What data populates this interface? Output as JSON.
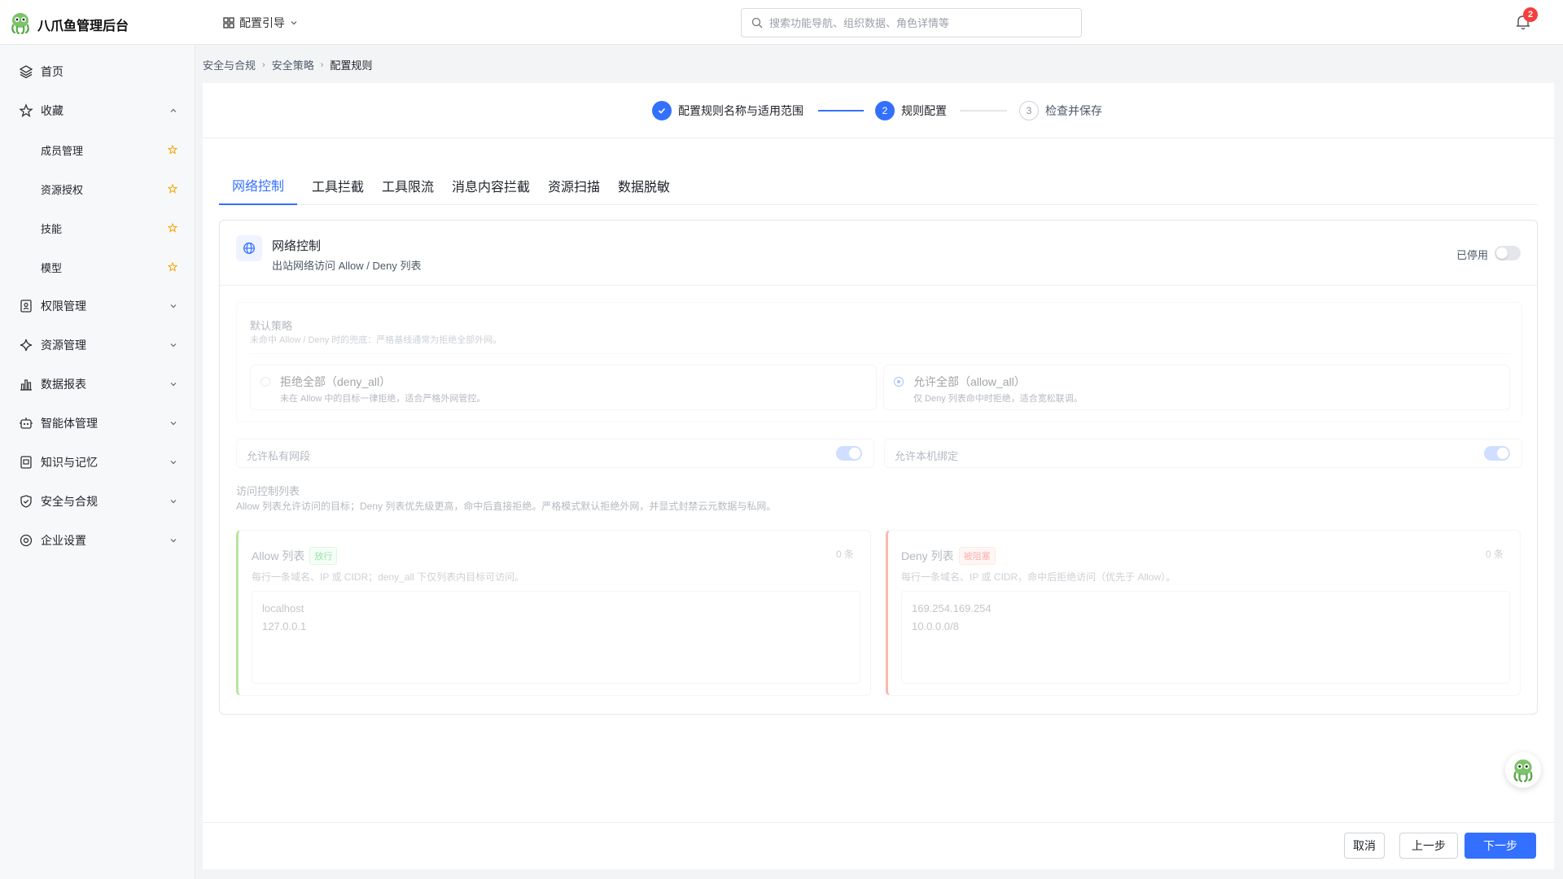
{
  "app": {
    "title": "八爪鱼管理后台",
    "guide_label": "配置引导"
  },
  "search": {
    "placeholder": "搜索功能导航、组织数据、角色详情等"
  },
  "notifications": {
    "count": "2"
  },
  "sidebar": {
    "items": [
      {
        "label": "首页",
        "icon": "layers-icon"
      },
      {
        "label": "收藏",
        "icon": "star-icon",
        "expanded": true
      },
      {
        "label": "成员管理",
        "sub": true
      },
      {
        "label": "资源授权",
        "sub": true
      },
      {
        "label": "技能",
        "sub": true
      },
      {
        "label": "模型",
        "sub": true
      },
      {
        "label": "权限管理",
        "icon": "badge-icon"
      },
      {
        "label": "资源管理",
        "icon": "sparkle-icon"
      },
      {
        "label": "数据报表",
        "icon": "bar-chart-icon"
      },
      {
        "label": "智能体管理",
        "icon": "robot-icon"
      },
      {
        "label": "知识与记忆",
        "icon": "book-icon"
      },
      {
        "label": "安全与合规",
        "icon": "shield-icon"
      },
      {
        "label": "企业设置",
        "icon": "gear-icon"
      }
    ]
  },
  "breadcrumb": [
    "安全与合规",
    "安全策略",
    "配置规则"
  ],
  "steps": [
    {
      "num": "1",
      "label": "配置规则名称与适用范围",
      "state": "done"
    },
    {
      "num": "2",
      "label": "规则配置",
      "state": "active"
    },
    {
      "num": "3",
      "label": "检查并保存",
      "state": "todo"
    }
  ],
  "tabs": [
    "网络控制",
    "工具拦截",
    "工具限流",
    "消息内容拦截",
    "资源扫描",
    "数据脱敏"
  ],
  "card": {
    "title": "网络控制",
    "subtitle": "出站网络访问 Allow / Deny 列表",
    "status": "已停用",
    "default_policy": {
      "title": "默认策略",
      "subtitle": "未命中 Allow / Deny 时的兜底：严格基线通常为拒绝全部外网。",
      "options": [
        {
          "title": "拒绝全部（deny_all）",
          "desc": "未在 Allow 中的目标一律拒绝，适合严格外网管控。",
          "selected": false
        },
        {
          "title": "允许全部（allow_all）",
          "desc": "仅 Deny 列表命中时拒绝，适合宽松联调。",
          "selected": true
        }
      ]
    },
    "toggles": [
      {
        "label": "允许私有网段",
        "on": true
      },
      {
        "label": "允许本机绑定",
        "on": true
      }
    ],
    "acl": {
      "title": "访问控制列表",
      "subtitle": "Allow 列表允许访问的目标；Deny 列表优先级更高，命中后直接拒绝。严格模式默认拒绝外网，并显式封禁云元数据与私网。",
      "allow": {
        "title": "Allow 列表",
        "tag": "放行",
        "count": "0 条",
        "desc": "每行一条域名、IP 或 CIDR；deny_all 下仅列表内目标可访问。",
        "placeholder": "localhost\n127.0.0.1"
      },
      "deny": {
        "title": "Deny 列表",
        "tag": "被阻塞",
        "count": "0 条",
        "desc": "每行一条域名、IP 或 CIDR，命中后拒绝访问（优先于 Allow）。",
        "placeholder": "169.254.169.254\n10.0.0.0/8"
      }
    }
  },
  "footer": {
    "cancel": "取消",
    "prev": "上一步",
    "next": "下一步"
  },
  "colors": {
    "primary": "#3370ff",
    "allow": "#52c41a",
    "deny": "#f5533d",
    "badge": "#f53f3f"
  }
}
